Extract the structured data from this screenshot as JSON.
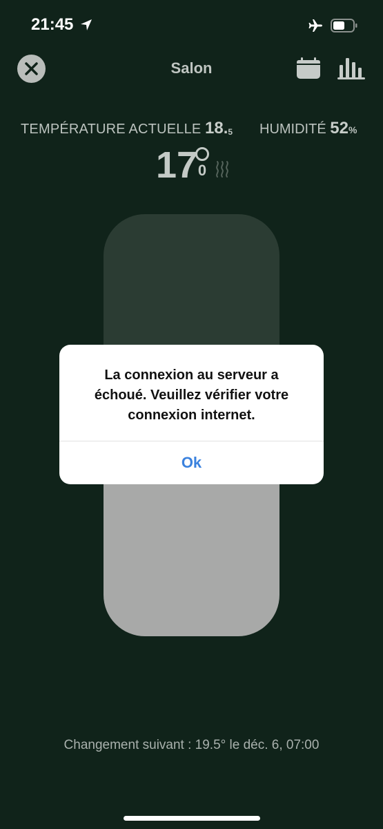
{
  "status_bar": {
    "time": "21:45"
  },
  "header": {
    "title": "Salon"
  },
  "readings": {
    "current_temp_label": "TEMPÉRATURE ACTUELLE",
    "current_temp_int": "18.",
    "current_temp_dec": "5",
    "humidity_label": "HUMIDITÉ",
    "humidity_value": "52",
    "humidity_unit": "%",
    "setpoint_int": "17",
    "setpoint_dec": "0"
  },
  "slider": {
    "level_fraction": 0.55
  },
  "dialog": {
    "message_line1": "La connexion au serveur a",
    "message_line2": "échoué. Veuillez vérifier votre",
    "message_line3": "connexion internet.",
    "ok_label": "Ok"
  },
  "footer": {
    "next_change": "Changement suivant : 19.5° le déc. 6, 07:00"
  },
  "colors": {
    "background": "#10231a",
    "accent": "#3b82de",
    "slider_fill": "#a8a9a8"
  }
}
